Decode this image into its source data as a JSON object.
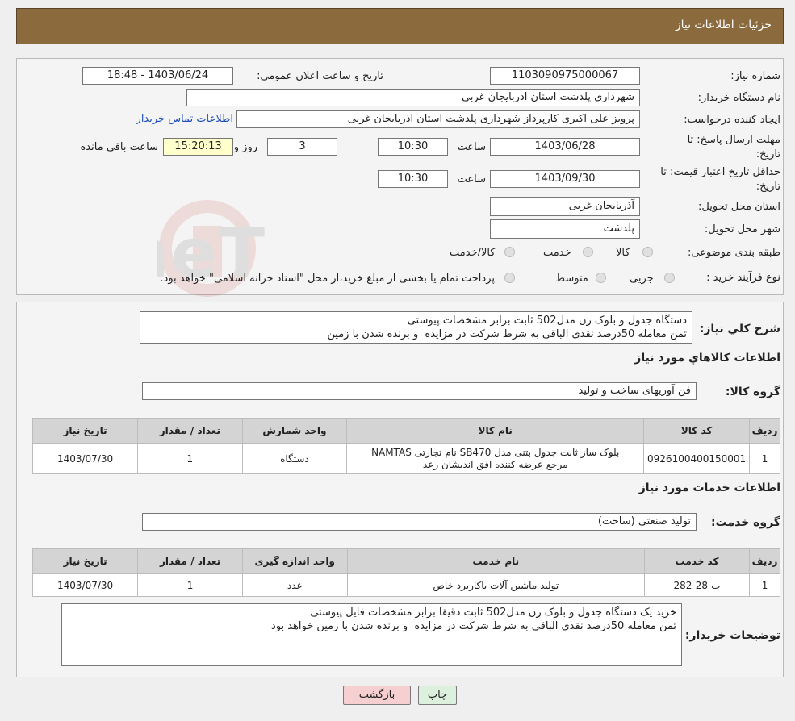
{
  "header": {
    "title": "جزئیات اطلاعات نیاز"
  },
  "info": {
    "need_number_label": "شماره نیاز:",
    "need_number": "1103090975000067",
    "announce_label": "تاریخ و ساعت اعلان عمومی:",
    "announce_value": "1403/06/24 - 18:48",
    "buyer_org_label": "نام دستگاه خریدار:",
    "buyer_org": "شهرداری پلدشت استان اذربایجان غربی",
    "creator_label": "ایجاد کننده درخواست:",
    "creator": "پرویز علی اکبری کارپرداز شهرداری پلدشت استان اذربایجان غربی",
    "contact_link": "اطلاعات تماس خریدار",
    "reply_deadline_label_1": "مهلت ارسال پاسخ: تا",
    "reply_deadline_label_2": "تاریخ:",
    "reply_date": "1403/06/28",
    "time_label": "ساعت",
    "reply_time": "10:30",
    "days": "3",
    "days_label": "روز و",
    "remaining_time": "15:20:13",
    "remaining_label": "ساعت باقي مانده",
    "validity_label_1": "حداقل تاریخ اعتبار قیمت: تا",
    "validity_label_2": "تاریخ:",
    "validity_date": "1403/09/30",
    "validity_time": "10:30",
    "province_label": "استان محل تحویل:",
    "province": "آذربایجان غربی",
    "city_label": "شهر محل تحویل:",
    "city": "پلدشت",
    "category_label": "طبقه بندی موضوعی:",
    "category_options": [
      "کالا",
      "خدمت",
      "کالا/خدمت"
    ],
    "process_label": "نوع فرآیند خرید :",
    "process_options": [
      "جزیی",
      "متوسط"
    ],
    "process_note": "پرداخت تمام یا بخشی از مبلغ خرید،از محل \"اسناد خزانه اسلامی\" خواهد بود."
  },
  "description": {
    "label": "شرح کلي نياز:",
    "text": "دستگاه جدول و بلوک زن مدل502 ثابت برابر مشخصات پیوستی\nثمن معامله 50درصد نقدی الباقی به شرط شرکت در مزایده  و برنده شدن با زمین"
  },
  "goods": {
    "section_title": "اطلاعات کالاهاي مورد نياز",
    "group_label": "گروه کالا:",
    "group_value": "فن آوریهای ساخت و تولید",
    "headers": [
      "رديف",
      "کد کالا",
      "نام کالا",
      "واحد شمارش",
      "تعداد / مقدار",
      "تاريخ نياز"
    ],
    "rows": [
      {
        "idx": "1",
        "code": "0926100400150001",
        "name_1": "بلوک ساز ثابت جدول بتنی مدل SB470 نام تجارتی NAMTAS",
        "name_2": "مرجع عرضه کننده افق اندیشان رعد",
        "unit": "دستگاه",
        "qty": "1",
        "date": "1403/07/30"
      }
    ]
  },
  "services": {
    "section_title": "اطلاعات خدمات مورد نياز",
    "group_label": "گروه خدمت:",
    "group_value": "تولید صنعتی (ساخت)",
    "headers": [
      "رديف",
      "کد خدمت",
      "نام خدمت",
      "واحد اندازه گيری",
      "تعداد / مقدار",
      "تاريخ نياز"
    ],
    "rows": [
      {
        "idx": "1",
        "code": "ب-28-282",
        "name": "تولید ماشین آلات باکاربرد خاص",
        "unit": "عدد",
        "qty": "1",
        "date": "1403/07/30"
      }
    ]
  },
  "buyer_notes": {
    "label": "توضیحات خریدار:",
    "text": "خرید یک دستگاه جدول و بلوک زن مدل502 ثابت دقیقا برابر مشخصات فایل پیوستی\nثمن معامله 50درصد نقدی الباقی به شرط شرکت در مزایده  و برنده شدن با زمین خواهد بود"
  },
  "buttons": {
    "print": "چاپ",
    "back": "بازگشت"
  },
  "watermark": {
    "text": "AriaTender.neT"
  },
  "colors": {
    "header_bg": "#8b6a3e",
    "link": "#1a4dbb",
    "remaining_bg": "#ffffcc",
    "back_btn_bg": "#f6d0d0",
    "print_btn_bg": "#ddf0dd"
  }
}
